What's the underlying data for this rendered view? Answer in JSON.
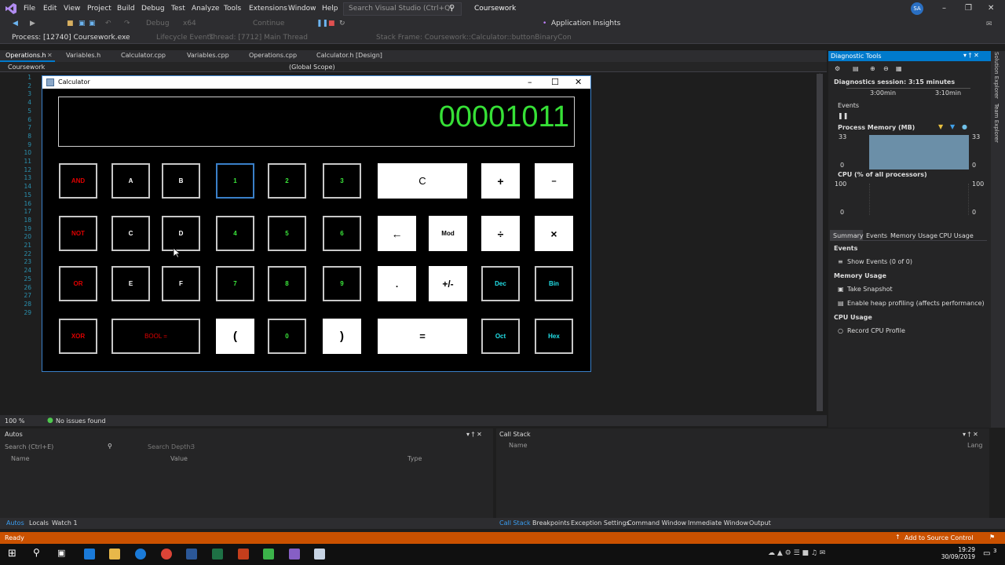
{
  "menu": {
    "items": [
      "File",
      "Edit",
      "View",
      "Project",
      "Build",
      "Debug",
      "Test",
      "Analyze",
      "Tools",
      "Extensions",
      "Window",
      "Help"
    ],
    "search_placeholder": "Search Visual Studio (Ctrl+Q)",
    "project_title": "Coursework",
    "user_initials": "SA"
  },
  "toolbar": {
    "config": "Debug",
    "platform": "x64",
    "continue_label": "Continue",
    "app_insights": "Application Insights",
    "process": "Process: [12740] Coursework.exe",
    "lifecycle": "Lifecycle Events",
    "thread": "Thread: [7712] Main Thread",
    "stack_frame": "Stack Frame: Coursework::Calculator::buttonBinaryCon"
  },
  "doc_tabs": [
    "Operations.h",
    "Variables.h",
    "Calculator.cpp",
    "Variables.cpp",
    "Operations.cpp",
    "Calculator.h [Design]"
  ],
  "nav": {
    "project": "Coursework",
    "scope": "(Global Scope)"
  },
  "line_numbers": [
    "1",
    "2",
    "3",
    "4",
    "5",
    "6",
    "7",
    "8",
    "9",
    "10",
    "11",
    "12",
    "13",
    "14",
    "15",
    "16",
    "17",
    "18",
    "19",
    "20",
    "21",
    "22",
    "23",
    "24",
    "25",
    "26",
    "27",
    "28",
    "29"
  ],
  "calculator": {
    "title": "Calculator",
    "display": "00001011",
    "buttons": {
      "and": "AND",
      "not": "NOT",
      "or": "OR",
      "xor": "XOR",
      "a": "A",
      "b": "B",
      "c": "C",
      "d": "D",
      "e": "E",
      "f": "F",
      "bool": "BOOL =",
      "n1": "1",
      "n2": "2",
      "n3": "3",
      "n4": "4",
      "n5": "5",
      "n6": "6",
      "n7": "7",
      "n8": "8",
      "n9": "9",
      "n0": "0",
      "lparen": "(",
      "rparen": ")",
      "clear": "C",
      "back": "←",
      "dot": ".",
      "equals": "=",
      "mod": "Mod",
      "plusminus": "+/-",
      "plus": "+",
      "minus": "–",
      "divide": "÷",
      "times": "×",
      "dec": "Dec",
      "bin": "Bin",
      "oct": "Oct",
      "hex": "Hex"
    }
  },
  "diagnostics": {
    "title": "Diagnostic Tools",
    "session": "Diagnostics session: 3:15 minutes",
    "time1": "3:00min",
    "time2": "3:10min",
    "events_label": "Events",
    "memory_label": "Process Memory (MB)",
    "mem_max": "33",
    "mem_min": "0",
    "cpu_label": "CPU (% of all processors)",
    "cpu_max": "100",
    "cpu_min": "0",
    "tabs": [
      "Summary",
      "Events",
      "Memory Usage",
      "CPU Usage"
    ],
    "section_events": "Events",
    "show_events": "Show Events (0 of 0)",
    "section_memory": "Memory Usage",
    "take_snapshot": "Take Snapshot",
    "heap_profiling": "Enable heap profiling (affects performance)",
    "section_cpu": "CPU Usage",
    "record_cpu": "Record CPU Profile"
  },
  "side_strip": [
    "Solution Explorer",
    "Team Explorer"
  ],
  "editor_status": {
    "zoom": "100 %",
    "issues": "No issues found"
  },
  "autos": {
    "title": "Autos",
    "search": "Search (Ctrl+E)",
    "search_depth": "Search Depth:",
    "depth_value": "3",
    "col_name": "Name",
    "col_value": "Value",
    "col_type": "Type"
  },
  "callstack": {
    "title": "Call Stack",
    "col_name": "Name",
    "col_lang": "Lang"
  },
  "bottom_tabs_left": [
    "Autos",
    "Locals",
    "Watch 1"
  ],
  "bottom_tabs_right": [
    "Call Stack",
    "Breakpoints",
    "Exception Settings",
    "Command Window",
    "Immediate Window",
    "Output"
  ],
  "status": {
    "ready": "Ready",
    "source_control": "Add to Source Control",
    "notifications": "3"
  },
  "clock": {
    "time": "19:29",
    "date": "30/09/2019"
  },
  "colors": {
    "status_bar": "#ca5100",
    "accent": "#007acc",
    "display_green": "#36e036"
  }
}
